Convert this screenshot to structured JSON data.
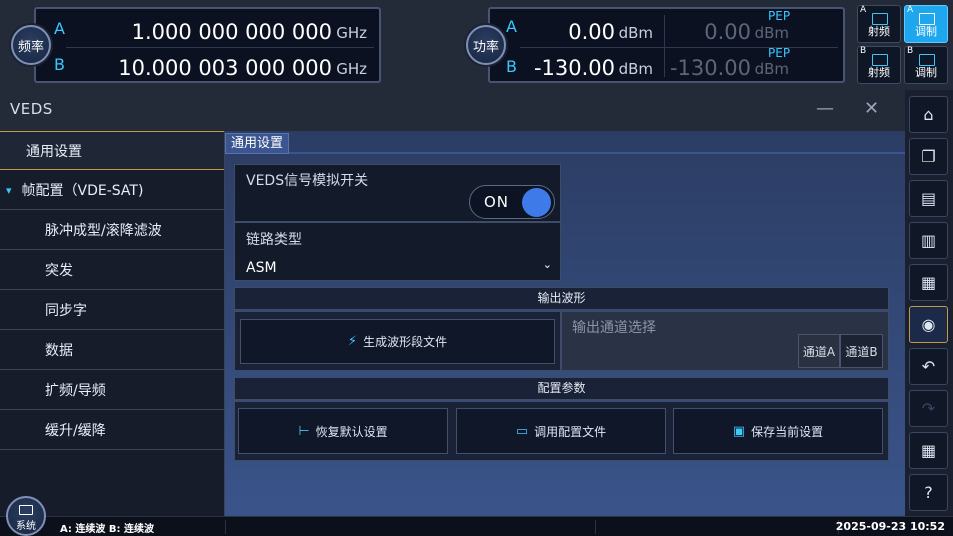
{
  "freq": {
    "button_label": "频率",
    "a_label": "A",
    "b_label": "B",
    "a_value": "1.000 000 000 000",
    "a_unit": "GHz",
    "b_value": "10.000 003 000 000",
    "b_unit": "GHz"
  },
  "power": {
    "button_label": "功率",
    "a_label": "A",
    "b_label": "B",
    "a_value": "0.00",
    "a_unit": "dBm",
    "b_value": "-130.00",
    "b_unit": "dBm",
    "a_pep_label": "PEP",
    "a_pep_value": "0.00",
    "a_pep_unit": "dBm",
    "b_pep_label": "PEP",
    "b_pep_value": "-130.00",
    "b_pep_unit": "dBm"
  },
  "mini_buttons": [
    {
      "channel": "A",
      "label": "射频"
    },
    {
      "channel": "A",
      "label": "调制"
    },
    {
      "channel": "B",
      "label": "射频"
    },
    {
      "channel": "B",
      "label": "调制"
    }
  ],
  "window": {
    "title": "VEDS",
    "minimize": "—",
    "close": "✕"
  },
  "nav": {
    "items": [
      {
        "label": "通用设置"
      },
      {
        "label": "帧配置（VDE-SAT)",
        "arrow": "▾"
      },
      {
        "label": "脉冲成型/滚降滤波"
      },
      {
        "label": "突发"
      },
      {
        "label": "同步字"
      },
      {
        "label": "数据"
      },
      {
        "label": "扩频/导频"
      },
      {
        "label": "缓升/缓降"
      }
    ]
  },
  "content": {
    "tab_label": "通用设置",
    "switch_label": "VEDS信号模拟开关",
    "switch_state": "ON",
    "link_type_label": "链路类型",
    "link_type_value": "ASM",
    "output_section": "输出波形",
    "generate_button": "生成波形段文件",
    "channel_select_placeholder": "输出通道选择",
    "channel_a": "通道A",
    "channel_b": "通道B",
    "config_section": "配置参数",
    "restore_button": "恢复默认设置",
    "load_button": "调用配置文件",
    "save_button": "保存当前设置"
  },
  "status": {
    "system_button": "系统",
    "mode_text": "A: 连续波 B: 连续波",
    "datetime": "2025-09-23 10:52"
  },
  "toolbar_icons": [
    "home-icon",
    "windows-icon",
    "monitor-icon",
    "scpi-icon",
    "scpi-screen-icon",
    "camera-icon",
    "undo-icon",
    "redo-icon",
    "apps-icon",
    "help-icon"
  ]
}
